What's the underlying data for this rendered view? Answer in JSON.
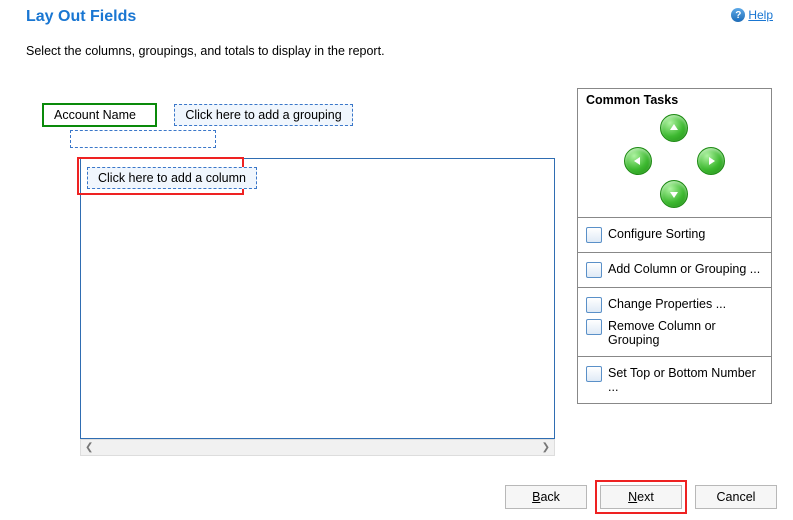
{
  "header": {
    "title": "Lay Out Fields",
    "help_label": "Help"
  },
  "instructions": "Select the columns, groupings, and totals to display in the report.",
  "fields": {
    "account_name": "Account Name",
    "add_grouping": "Click here to add a grouping",
    "add_column": "Click here to add a column"
  },
  "sidebar": {
    "title": "Common Tasks",
    "configure_sorting": "Configure Sorting",
    "add_column_grouping": "Add Column or Grouping ...",
    "change_properties": "Change Properties ...",
    "remove_column_grouping": "Remove Column or Grouping",
    "set_top_bottom": "Set Top or Bottom Number ..."
  },
  "footer": {
    "back": "Back",
    "next": "Next",
    "cancel": "Cancel"
  }
}
